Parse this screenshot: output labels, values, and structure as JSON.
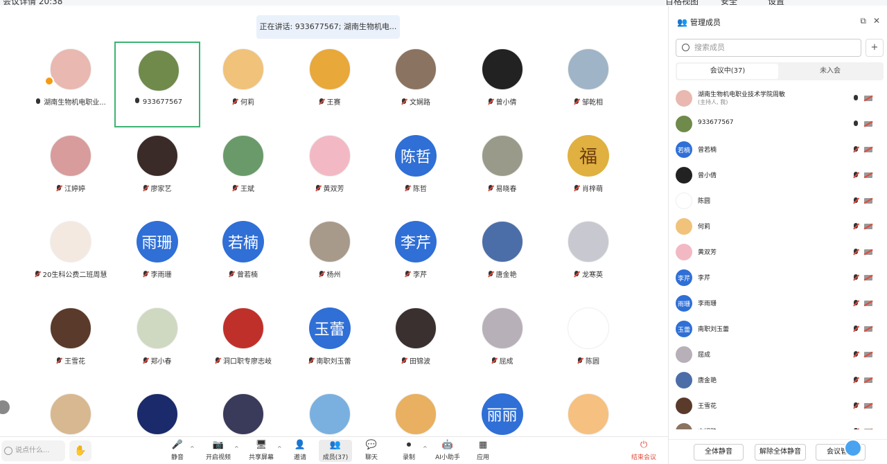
{
  "top_bar": {
    "left_text": "会议详情  20:38",
    "right_items": [
      "百格视图",
      "安全",
      "设置"
    ]
  },
  "speaking_banner": "正在讲话: 933677567; 湖南生物机电...",
  "grid": [
    {
      "name": "湖南生物机电职业...",
      "mic": "on",
      "avatar": "photo",
      "color": "#e9b8b0",
      "host": true
    },
    {
      "name": "933677567",
      "mic": "on",
      "avatar": "photo",
      "color": "#6f8a4a",
      "active": true
    },
    {
      "name": "何莉",
      "mic": "muted",
      "avatar": "photo",
      "color": "#f0c27a"
    },
    {
      "name": "王赛",
      "mic": "muted",
      "avatar": "photo",
      "color": "#e8a83a"
    },
    {
      "name": "文娴路",
      "mic": "muted",
      "avatar": "photo",
      "color": "#8a7360"
    },
    {
      "name": "曾小倩",
      "mic": "muted",
      "avatar": "photo",
      "color": "#222222"
    },
    {
      "name": "邹乾相",
      "mic": "muted",
      "avatar": "photo",
      "color": "#9fb4c6"
    },
    {
      "name": "江婷婷",
      "mic": "muted",
      "avatar": "photo",
      "color": "#d89c9c"
    },
    {
      "name": "廖家艺",
      "mic": "muted",
      "avatar": "photo",
      "color": "#3a2b28"
    },
    {
      "name": "王斌",
      "mic": "muted",
      "avatar": "photo",
      "color": "#6a9a6a"
    },
    {
      "name": "黄双芳",
      "mic": "muted",
      "avatar": "photo",
      "color": "#f2b9c4"
    },
    {
      "name": "陈哲",
      "mic": "muted",
      "avatar": "text",
      "text": "陈哲",
      "color": "#2f6fd6"
    },
    {
      "name": "易晓春",
      "mic": "muted",
      "avatar": "photo",
      "color": "#9a9a8a"
    },
    {
      "name": "肖梓萌",
      "mic": "muted",
      "avatar": "text",
      "text": "福",
      "color": "#e0b040"
    },
    {
      "name": "20生科公费二班周慧",
      "mic": "muted",
      "avatar": "photo",
      "color": "#f4e9e0"
    },
    {
      "name": "李雨珊",
      "mic": "muted",
      "avatar": "text",
      "text": "雨珊",
      "color": "#2f6fd6"
    },
    {
      "name": "曾若楠",
      "mic": "muted",
      "avatar": "text",
      "text": "若楠",
      "color": "#2f6fd6"
    },
    {
      "name": "杨州",
      "mic": "muted",
      "avatar": "photo",
      "color": "#a89a8a"
    },
    {
      "name": "李芹",
      "mic": "muted",
      "avatar": "text",
      "text": "李芹",
      "color": "#2f6fd6"
    },
    {
      "name": "唐金艳",
      "mic": "muted",
      "avatar": "photo",
      "color": "#4c6ea8"
    },
    {
      "name": "龙寒英",
      "mic": "muted",
      "avatar": "photo",
      "color": "#c8c8d0"
    },
    {
      "name": "王雪花",
      "mic": "muted",
      "avatar": "photo",
      "color": "#5a3a2a"
    },
    {
      "name": "郑小春",
      "mic": "muted",
      "avatar": "photo",
      "color": "#cfd8c0"
    },
    {
      "name": "洞口职专廖志岐",
      "mic": "muted",
      "avatar": "photo",
      "color": "#c0302a"
    },
    {
      "name": "南职刘玉蕾",
      "mic": "muted",
      "avatar": "text",
      "text": "玉蕾",
      "color": "#2f6fd6"
    },
    {
      "name": "田锦波",
      "mic": "muted",
      "avatar": "photo",
      "color": "#3a3030"
    },
    {
      "name": "屈成",
      "mic": "muted",
      "avatar": "photo",
      "color": "#b8b0b8"
    },
    {
      "name": "陈圆",
      "mic": "muted",
      "avatar": "photo",
      "color": "#ffffff"
    },
    {
      "name": "",
      "mic": "none",
      "avatar": "photo",
      "color": "#d8b890"
    },
    {
      "name": "",
      "mic": "none",
      "avatar": "photo",
      "color": "#1a2a6a"
    },
    {
      "name": "",
      "mic": "none",
      "avatar": "photo",
      "color": "#3a3a5a"
    },
    {
      "name": "",
      "mic": "none",
      "avatar": "photo",
      "color": "#7ab0e0"
    },
    {
      "name": "",
      "mic": "none",
      "avatar": "photo",
      "color": "#e8b060"
    },
    {
      "name": "",
      "mic": "none",
      "avatar": "text",
      "text": "丽丽",
      "color": "#2f6fd6"
    },
    {
      "name": "",
      "mic": "none",
      "avatar": "photo",
      "color": "#f6c080"
    }
  ],
  "bottom_bar": {
    "say_placeholder": "说点什么...",
    "tools": [
      {
        "label": "静音",
        "icon": "mic-icon"
      },
      {
        "label": "开启视频",
        "icon": "camera-off-icon"
      },
      {
        "label": "共享屏幕",
        "icon": "share-screen-icon"
      },
      {
        "label": "邀请",
        "icon": "invite-icon"
      },
      {
        "label": "成员(37)",
        "icon": "members-icon"
      },
      {
        "label": "聊天",
        "icon": "chat-icon"
      },
      {
        "label": "录制",
        "icon": "record-icon"
      },
      {
        "label": "AI小助手",
        "icon": "ai-assistant-icon"
      },
      {
        "label": "应用",
        "icon": "apps-icon"
      },
      {
        "label": "结束会议",
        "icon": "end-meeting-icon"
      }
    ]
  },
  "panel": {
    "title": "管理成员",
    "search_placeholder": "搜索成员",
    "tab_in": "会议中(37)",
    "tab_out": "未入会",
    "members": [
      {
        "name": "湖南生物机电职业技术学院周敏",
        "sub": "(主持人, 我)",
        "avatar": "photo",
        "color": "#e9b8b0",
        "mic": "on"
      },
      {
        "name": "933677567",
        "avatar": "photo",
        "color": "#6f8a4a",
        "mic": "on"
      },
      {
        "name": "曾若楠",
        "avatar": "text",
        "text": "若楠",
        "color": "#2f6fd6",
        "mic": "muted"
      },
      {
        "name": "曾小倩",
        "avatar": "photo",
        "color": "#222222",
        "mic": "muted"
      },
      {
        "name": "陈圆",
        "avatar": "photo",
        "color": "#ffffff",
        "mic": "muted"
      },
      {
        "name": "何莉",
        "avatar": "photo",
        "color": "#f0c27a",
        "mic": "muted"
      },
      {
        "name": "黄双芳",
        "avatar": "photo",
        "color": "#f2b9c4",
        "mic": "muted"
      },
      {
        "name": "李芹",
        "avatar": "text",
        "text": "李芹",
        "color": "#2f6fd6",
        "mic": "muted"
      },
      {
        "name": "李雨珊",
        "avatar": "text",
        "text": "雨珊",
        "color": "#2f6fd6",
        "mic": "muted"
      },
      {
        "name": "南职刘玉蕾",
        "avatar": "text",
        "text": "玉蕾",
        "color": "#2f6fd6",
        "mic": "muted"
      },
      {
        "name": "屈成",
        "avatar": "photo",
        "color": "#b8b0b8",
        "mic": "muted"
      },
      {
        "name": "唐金艳",
        "avatar": "photo",
        "color": "#4c6ea8",
        "mic": "muted"
      },
      {
        "name": "王雪花",
        "avatar": "photo",
        "color": "#5a3a2a",
        "mic": "muted"
      },
      {
        "name": "文娴路",
        "avatar": "photo",
        "color": "#8a7360",
        "mic": "muted"
      }
    ],
    "footer": {
      "mute_all": "全体静音",
      "unmute_all": "解除全体静音",
      "manage": "会议管理"
    }
  }
}
